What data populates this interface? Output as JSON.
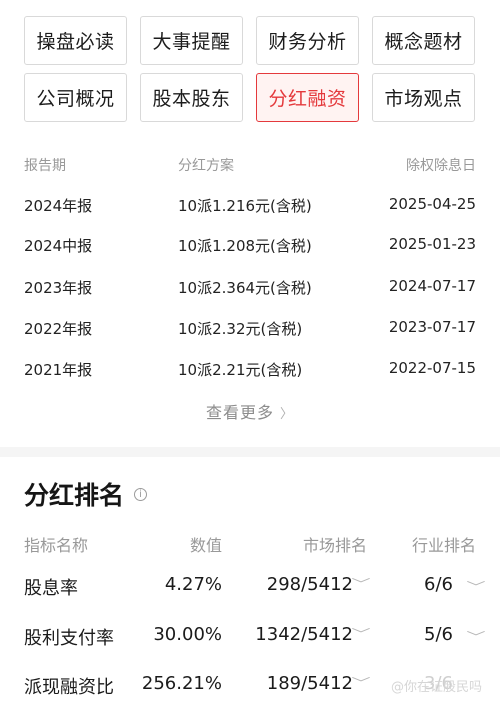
{
  "tabs": [
    {
      "label": "操盘必读"
    },
    {
      "label": "大事提醒"
    },
    {
      "label": "财务分析"
    },
    {
      "label": "概念题材"
    },
    {
      "label": "公司概况"
    },
    {
      "label": "股本股东"
    },
    {
      "label": "分红融资",
      "active": true
    },
    {
      "label": "市场观点"
    }
  ],
  "dividend_table": {
    "headers": {
      "period": "报告期",
      "plan": "分红方案",
      "ex_date": "除权除息日"
    },
    "rows": [
      {
        "period": "2024年报",
        "plan": "10派1.216元(含税)",
        "ex_date": "2025-04-25"
      },
      {
        "period": "2024中报",
        "plan": "10派1.208元(含税)",
        "ex_date": "2025-01-23"
      },
      {
        "period": "2023年报",
        "plan": "10派2.364元(含税)",
        "ex_date": "2024-07-17"
      },
      {
        "period": "2022年报",
        "plan": "10派2.32元(含税)",
        "ex_date": "2023-07-17"
      },
      {
        "period": "2021年报",
        "plan": "10派2.21元(含税)",
        "ex_date": "2022-07-15"
      }
    ],
    "more_label": "查看更多",
    "more_chevron": "〉"
  },
  "ranking": {
    "title": "分红排名",
    "info_glyph": "i",
    "headers": {
      "name": "指标名称",
      "value": "数值",
      "market_rank": "市场排名",
      "industry_rank": "行业排名"
    },
    "rows": [
      {
        "name": "股息率",
        "value": "4.27%",
        "market_rank": "298/5412",
        "industry_rank": "6/6"
      },
      {
        "name": "股利支付率",
        "value": "30.00%",
        "market_rank": "1342/5412",
        "industry_rank": "5/6"
      },
      {
        "name": "派现融资比",
        "value": "256.21%",
        "market_rank": "189/5412",
        "industry_rank": "3/6"
      }
    ],
    "dropdown_glyph": "﹀"
  },
  "watermark": "@你在证股民吗",
  "colors": {
    "accent": "#e4393c",
    "accent_bg": "#fff3f2",
    "muted": "#999999",
    "separator": "#f5f5f5"
  }
}
